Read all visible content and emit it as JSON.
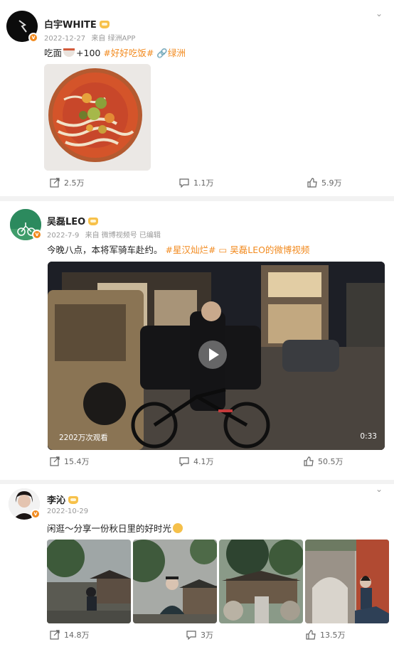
{
  "posts": [
    {
      "author": "白宇WHITE",
      "date": "2022-12-27",
      "source": "来自 绿洲APP",
      "text_prefix": "吃面",
      "text_suffix": "+100",
      "tag": "#好好吃饭#",
      "link": "🔗绿洲",
      "reposts": "2.5万",
      "comments": "1.1万",
      "likes": "5.9万"
    },
    {
      "author": "吴磊LEO",
      "date": "2022-7-9",
      "source": "来自 微博视频号 已编辑",
      "text": "今晚八点，本将军骑车赴约。",
      "tag": "#星汉灿烂#",
      "link": "吴磊LEO的微博视频",
      "views": "2202万次观看",
      "duration": "0:33",
      "reposts": "15.4万",
      "comments": "4.1万",
      "likes": "50.5万"
    },
    {
      "author": "李沁",
      "date": "2022-10-29",
      "text": "闲逛～分享一份秋日里的好时光",
      "reposts": "14.8万",
      "comments": "3万",
      "likes": "13.5万"
    }
  ],
  "icons": {
    "repost": "share-icon",
    "comment": "comment-icon",
    "like": "thumbs-up-icon",
    "verified": "verified-badge-icon",
    "more": "chevron-down-icon"
  },
  "colors": {
    "accent": "#f28a1e",
    "text": "#222222",
    "meta": "#999999"
  }
}
